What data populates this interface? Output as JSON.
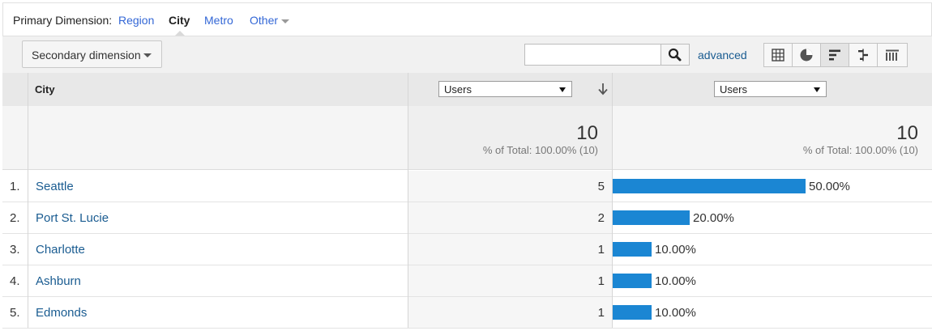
{
  "primary_dimension": {
    "label": "Primary Dimension:",
    "options": [
      "Region",
      "City",
      "Metro",
      "Other"
    ],
    "active": "City"
  },
  "toolbar": {
    "secondary_dimension_label": "Secondary dimension",
    "search_value": "",
    "advanced_label": "advanced",
    "view_icons": [
      "grid-icon",
      "pie-icon",
      "bar-icon",
      "comparison-icon",
      "pivot-icon"
    ],
    "active_view": "bar-icon"
  },
  "table": {
    "city_header": "City",
    "metric_select_1": "Users",
    "metric_select_2": "Users",
    "totals": {
      "value_1": "10",
      "pct_1": "% of Total: 100.00% (10)",
      "value_2": "10",
      "pct_2": "% of Total: 100.00% (10)"
    },
    "rows": [
      {
        "index": "1.",
        "city": "Seattle",
        "users": "5",
        "percent": "50.00%",
        "share": 0.5
      },
      {
        "index": "2.",
        "city": "Port St. Lucie",
        "users": "2",
        "percent": "20.00%",
        "share": 0.2
      },
      {
        "index": "3.",
        "city": "Charlotte",
        "users": "1",
        "percent": "10.00%",
        "share": 0.1
      },
      {
        "index": "4.",
        "city": "Ashburn",
        "users": "1",
        "percent": "10.00%",
        "share": 0.1
      },
      {
        "index": "5.",
        "city": "Edmonds",
        "users": "1",
        "percent": "10.00%",
        "share": 0.1
      }
    ]
  },
  "colors": {
    "link": "#1a5c91",
    "bar": "#1b86d3",
    "tab_link": "#3367d6"
  }
}
